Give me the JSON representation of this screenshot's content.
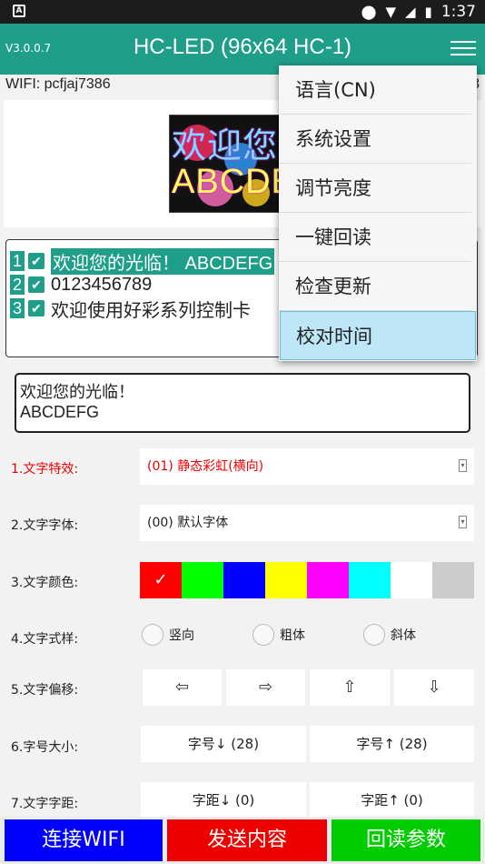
{
  "status_bar": {
    "left_icon": "A",
    "time": "1:37",
    "icons": [
      "location-icon",
      "wifi-icon",
      "signal-icon",
      "battery-icon"
    ]
  },
  "app_bar": {
    "version": "V3.0.0.7",
    "title": "HC-LED (96x64 HC-1)",
    "menu_icon": "hamburger-icon",
    "accent": "#1f9e8a"
  },
  "wifi": {
    "label": "WIFI: pcfjaj7386",
    "tail": "3"
  },
  "preview": {
    "line1": "欢迎您",
    "line2": "ABCDE"
  },
  "programs": [
    {
      "num": "1",
      "checked": true,
      "text": "欢迎您的光临！ ABCDEFG",
      "selected": true
    },
    {
      "num": "2",
      "checked": true,
      "text": "0123456789",
      "selected": false
    },
    {
      "num": "3",
      "checked": true,
      "text": "欢迎使用好彩系列控制卡",
      "selected": false
    }
  ],
  "edit_text": {
    "line1": "欢迎您的光临！",
    "line2": "ABCDEFG"
  },
  "settings": {
    "effect": {
      "label": "1.文字特效:",
      "value": "(01) 静态彩虹(横向)"
    },
    "font": {
      "label": "2.文字字体:",
      "value": "(00) 默认字体"
    },
    "color": {
      "label": "3.文字颜色:",
      "selected_mark": "✓",
      "swatches": [
        "#ff0000",
        "#00ff00",
        "#0000ff",
        "#ffff00",
        "#ff00ff",
        "#00ffff",
        "#ffffff",
        "#cccccc"
      ]
    },
    "style": {
      "label": "4.文字式样:",
      "options": [
        "竖向",
        "粗体",
        "斜体"
      ]
    },
    "offset": {
      "label": "5.文字偏移:",
      "arrows": [
        "⇦",
        "⇨",
        "⇧",
        "⇩"
      ]
    },
    "size": {
      "label": "6.字号大小:",
      "down": "字号↓ (28)",
      "up": "字号↑ (28)"
    },
    "spacing": {
      "label": "7.文字字距:",
      "down": "字距↓ (0)",
      "up": "字距↑ (0)"
    }
  },
  "bottom": {
    "connect": {
      "label": "连接WIFI",
      "color": "#0000ff"
    },
    "send": {
      "label": "发送内容",
      "color": "#ff0000"
    },
    "readback": {
      "label": "回读参数",
      "color": "#00cc00"
    }
  },
  "menu": {
    "items": [
      "语言(CN)",
      "系统设置",
      "调节亮度",
      "一键回读",
      "检查更新",
      "校对时间"
    ],
    "active_index": 5
  }
}
